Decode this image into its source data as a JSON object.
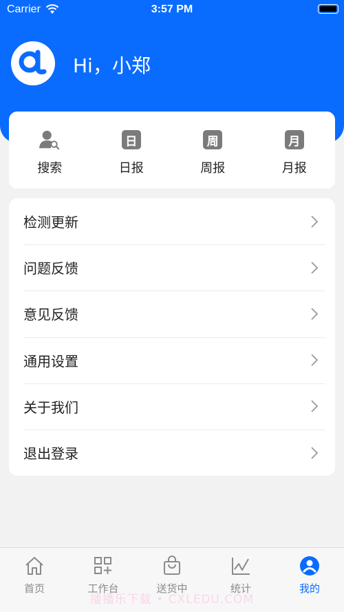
{
  "status_bar": {
    "carrier": "Carrier",
    "time": "3:57 PM"
  },
  "header": {
    "greeting": "Hi，小郑",
    "avatar_icon": "alpha-logo-icon",
    "bg_color": "#0a6cff"
  },
  "quick_actions": [
    {
      "label": "搜索",
      "icon": "user-search-icon"
    },
    {
      "label": "日报",
      "icon": "day-report-icon",
      "glyph": "日"
    },
    {
      "label": "周报",
      "icon": "week-report-icon",
      "glyph": "周"
    },
    {
      "label": "月报",
      "icon": "month-report-icon",
      "glyph": "月"
    }
  ],
  "menu": [
    {
      "label": "检测更新"
    },
    {
      "label": "问题反馈"
    },
    {
      "label": "意见反馈"
    },
    {
      "label": "通用设置"
    },
    {
      "label": "关于我们"
    },
    {
      "label": "退出登录"
    }
  ],
  "tabs": [
    {
      "label": "首页",
      "icon": "home-icon"
    },
    {
      "label": "工作台",
      "icon": "grid-plus-icon"
    },
    {
      "label": "送货中",
      "icon": "shopping-bag-icon"
    },
    {
      "label": "统计",
      "icon": "line-chart-icon"
    },
    {
      "label": "我的",
      "icon": "profile-icon",
      "active": true
    }
  ],
  "watermark": "播播乐下载 • CXLEDU.COM"
}
